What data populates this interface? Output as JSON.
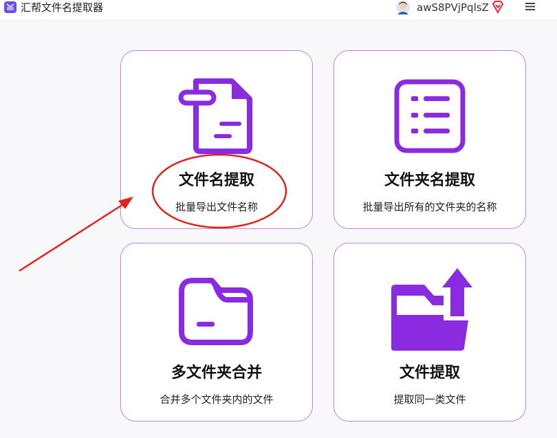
{
  "app": {
    "title": "汇帮文件名提取器",
    "logo_icon": "app-logo-icon"
  },
  "header": {
    "username": "awS8PVjPqlsZ",
    "avatar_icon": "user-avatar-icon",
    "vip_icon": "vip-diamond-icon",
    "menu_icon": "hamburger-menu-icon"
  },
  "cards": [
    {
      "title": "文件名提取",
      "subtitle": "批量导出文件名称",
      "icon": "file-document-icon"
    },
    {
      "title": "文件夹名提取",
      "subtitle": "批量导出所有的文件夹的名称",
      "icon": "list-icon"
    },
    {
      "title": "多文件夹合并",
      "subtitle": "合并多个文件夹内的文件",
      "icon": "folder-icon"
    },
    {
      "title": "文件提取",
      "subtitle": "提取同一类文件",
      "icon": "folder-upload-icon"
    }
  ],
  "colors": {
    "accent": "#8a2be2",
    "card_border": "#c87fe0",
    "annotation": "#e0231b",
    "vip": "#e8283a"
  }
}
